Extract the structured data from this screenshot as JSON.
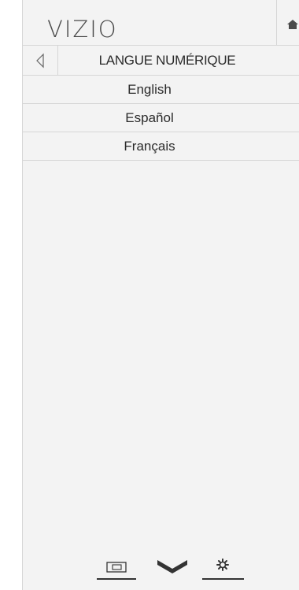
{
  "header": {
    "logo_text": "VIZIO",
    "home_icon": "home-icon"
  },
  "title_bar": {
    "back_icon": "back-arrow-icon",
    "title": "LANGUE NUMÉRIQUE"
  },
  "languages": [
    {
      "label": "English"
    },
    {
      "label": "Español"
    },
    {
      "label": "Français"
    }
  ],
  "bottom_nav": {
    "items": [
      {
        "icon": "input-icon"
      },
      {
        "icon": "chevron-down-icon"
      },
      {
        "icon": "gear-icon"
      }
    ]
  },
  "colors": {
    "panel_background": "#f3f3f3",
    "divider": "#d6d6d6",
    "text": "#2b2b2b",
    "icon": "#333333"
  }
}
